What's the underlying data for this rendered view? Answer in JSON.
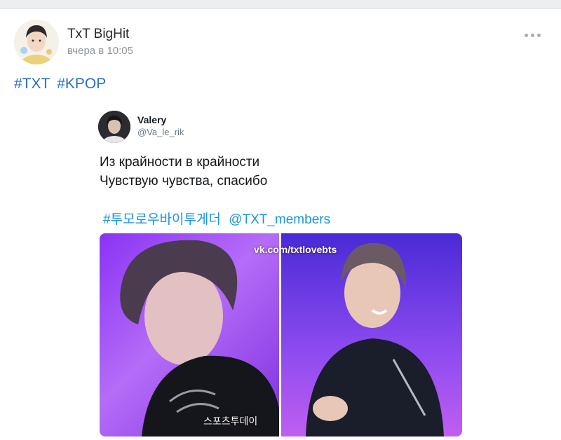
{
  "post": {
    "author": "TxT BigHit",
    "date": "вчера в 10:05",
    "hashtags": [
      "#TXT",
      "#KPOP"
    ]
  },
  "tweet": {
    "name": "Valery",
    "handle": "@Va_le_rik",
    "text": "Из крайности в крайности\nЧувствую чувства, спасибо",
    "hashtag": "#투모로우바이투게더",
    "mention": "@TXT_members"
  },
  "media": {
    "watermark": "vk.com/txtlovebts",
    "caption": "스포츠투데이"
  },
  "colors": {
    "link": "#2a6fc1",
    "tweet_link": "#1b95e0",
    "background": "#ffffff"
  },
  "icons": {
    "more": "more-horizontal-icon"
  }
}
